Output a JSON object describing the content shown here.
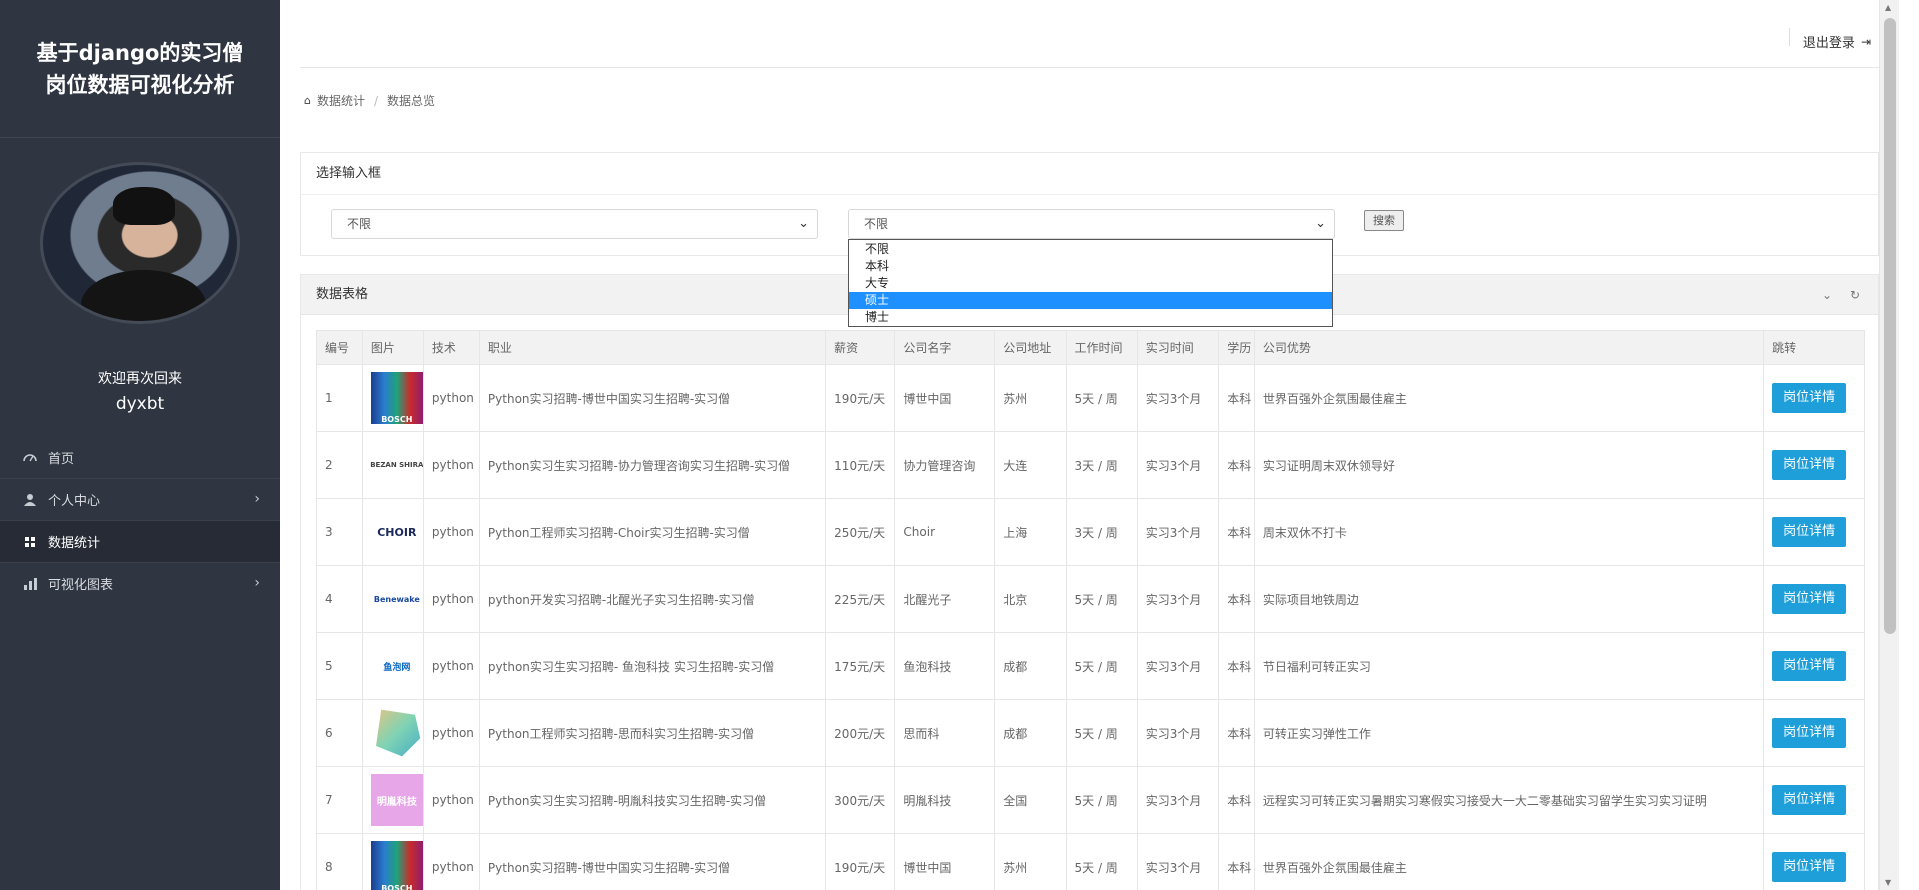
{
  "sidebar": {
    "title_line1": "基于django的实习僧",
    "title_line2": "岗位数据可视化分析",
    "welcome": "欢迎再次回来",
    "username": "dyxbt",
    "nav": [
      {
        "label": "首页",
        "icon": "gauge-icon"
      },
      {
        "label": "个人中心",
        "icon": "user-icon",
        "arrow": true
      },
      {
        "label": "数据统计",
        "icon": "grid-icon",
        "active": true
      },
      {
        "label": "可视化图表",
        "icon": "bar-chart-icon",
        "arrow": true
      }
    ]
  },
  "topbar": {
    "logout": "退出登录"
  },
  "breadcrumb": {
    "home": "数据统计",
    "current": "数据总览"
  },
  "filter": {
    "title": "选择输入框",
    "select1_value": "不限",
    "select2_value": "不限",
    "search_label": "搜索",
    "options": [
      "不限",
      "本科",
      "大专",
      "硕士",
      "博士"
    ],
    "highlighted_option": "硕士"
  },
  "table": {
    "title": "数据表格",
    "headers": [
      "编号",
      "图片",
      "技术",
      "职业",
      "薪资",
      "公司名字",
      "公司地址",
      "工作时间",
      "实习时间",
      "学历",
      "公司优势",
      "跳转"
    ],
    "button_label": "岗位详情",
    "rows": [
      {
        "id": "1",
        "logo": "BOSCH",
        "logo_style": "bosch",
        "tech": "python",
        "job": "Python实习招聘-博世中国实习生招聘-实习僧",
        "salary": "190元/天",
        "company": "博世中国",
        "city": "苏州",
        "work": "5天 / 周",
        "intern": "实习3个月",
        "edu": "本科",
        "adv": "世界百强外企氛围最佳雇主"
      },
      {
        "id": "2",
        "logo": "BEZAN SHIRA",
        "logo_style": "bezan",
        "tech": "python",
        "job": "Python实习生实习招聘-协力管理咨询实习生招聘-实习僧",
        "salary": "110元/天",
        "company": "协力管理咨询",
        "city": "大连",
        "work": "3天 / 周",
        "intern": "实习3个月",
        "edu": "本科",
        "adv": "实习证明周末双休领导好"
      },
      {
        "id": "3",
        "logo": "CHOIR",
        "logo_style": "choir",
        "tech": "python",
        "job": "Python工程师实习招聘-Choir实习生招聘-实习僧",
        "salary": "250元/天",
        "company": "Choir",
        "city": "上海",
        "work": "3天 / 周",
        "intern": "实习3个月",
        "edu": "本科",
        "adv": "周末双休不打卡"
      },
      {
        "id": "4",
        "logo": "Benewake",
        "logo_style": "bene",
        "tech": "python",
        "job": "python开发实习招聘-北醒光子实习生招聘-实习僧",
        "salary": "225元/天",
        "company": "北醒光子",
        "city": "北京",
        "work": "5天 / 周",
        "intern": "实习3个月",
        "edu": "本科",
        "adv": "实际项目地铁周边"
      },
      {
        "id": "5",
        "logo": "鱼泡网",
        "logo_style": "yupao",
        "tech": "python",
        "job": "python实习生实习招聘- 鱼泡科技 实习生招聘-实习僧",
        "salary": "175元/天",
        "company": "鱼泡科技",
        "city": "成都",
        "work": "5天 / 周",
        "intern": "实习3个月",
        "edu": "本科",
        "adv": "节日福利可转正实习"
      },
      {
        "id": "6",
        "logo": "",
        "logo_style": "sierke",
        "tech": "python",
        "job": "Python工程师实习招聘-思而科实习生招聘-实习僧",
        "salary": "200元/天",
        "company": "思而科",
        "city": "成都",
        "work": "5天 / 周",
        "intern": "实习3个月",
        "edu": "本科",
        "adv": "可转正实习弹性工作"
      },
      {
        "id": "7",
        "logo": "明胤科技",
        "logo_style": "mingyin",
        "tech": "python",
        "job": "Python实习生实习招聘-明胤科技实习生招聘-实习僧",
        "salary": "300元/天",
        "company": "明胤科技",
        "city": "全国",
        "work": "5天 / 周",
        "intern": "实习3个月",
        "edu": "本科",
        "adv": "远程实习可转正实习暑期实习寒假实习接受大一大二零基础实习留学生实习实习证明"
      },
      {
        "id": "8",
        "logo": "BOSCH",
        "logo_style": "bosch",
        "tech": "python",
        "job": "Python实习招聘-博世中国实习生招聘-实习僧",
        "salary": "190元/天",
        "company": "博世中国",
        "city": "苏州",
        "work": "5天 / 周",
        "intern": "实习3个月",
        "edu": "本科",
        "adv": "世界百强外企氛围最佳雇主"
      }
    ]
  }
}
